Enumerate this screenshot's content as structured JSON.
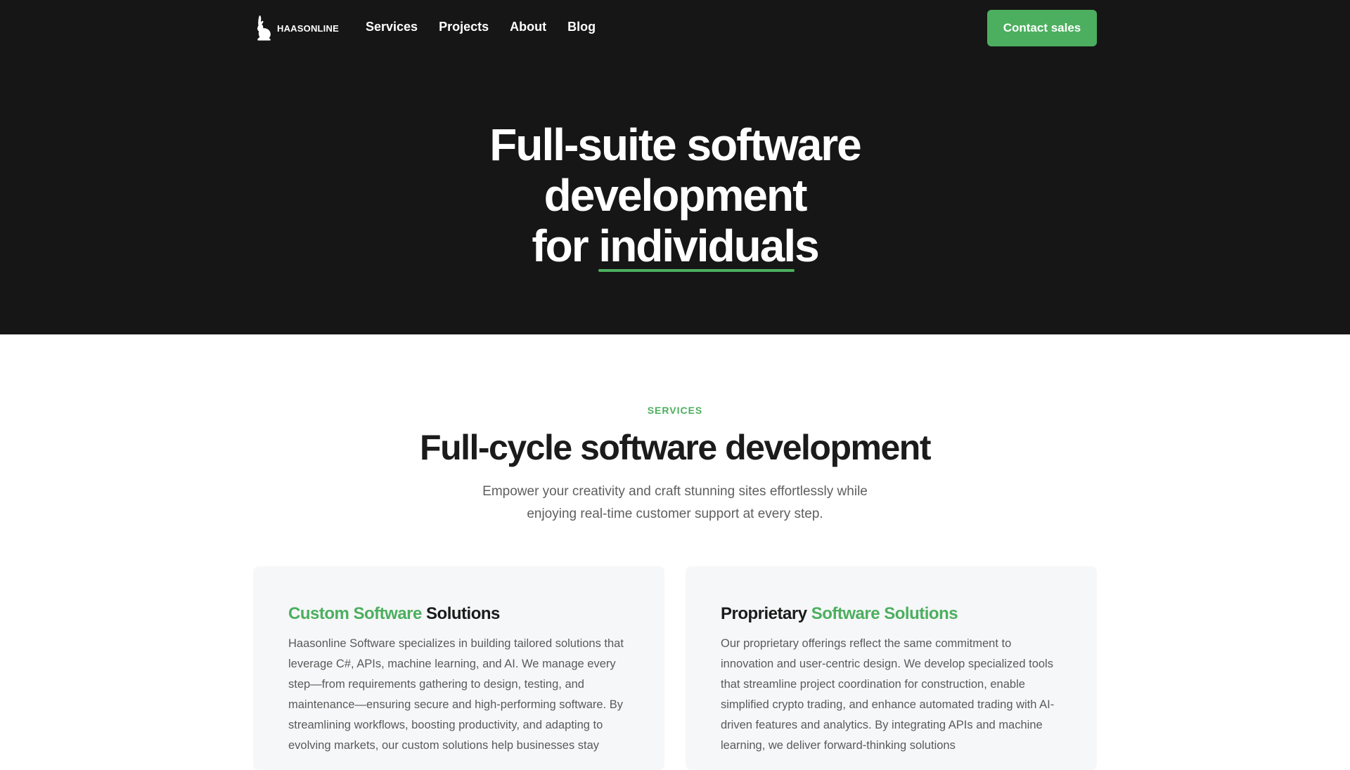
{
  "header": {
    "logo_text": "HAASONLINE",
    "nav": [
      "Services",
      "Projects",
      "About",
      "Blog"
    ],
    "cta_label": "Contact sales"
  },
  "hero": {
    "line1": "Full-suite software",
    "line2": "development",
    "line3_prefix": "for",
    "line3_highlight": "individuals"
  },
  "services": {
    "eyebrow": "SERVICES",
    "title": "Full-cycle software development",
    "subtitle_line1": "Empower your creativity and craft stunning sites effortlessly while",
    "subtitle_line2": "enjoying real-time customer support at every step.",
    "cards": [
      {
        "title_accent": "Custom Software",
        "title_rest": "Solutions",
        "body": "Haasonline Software specializes in building tailored solutions that leverage C#, APIs, machine learning, and AI. We manage every step—from requirements gathering to design, testing, and maintenance—ensuring secure and high-performing software. By streamlining workflows, boosting productivity, and adapting to evolving markets, our custom solutions help businesses stay"
      },
      {
        "title_prefix": "Proprietary",
        "title_accent": "Software Solutions",
        "body": "Our proprietary offerings reflect the same commitment to innovation and user-centric design. We develop specialized tools that streamline project coordination for construction, enable simplified crypto trading, and enhance automated trading with AI-driven features and analytics. By integrating APIs and machine learning, we deliver forward-thinking solutions"
      }
    ]
  },
  "colors": {
    "hero_bg": "#161616",
    "accent_green": "#4caf5f",
    "card_bg": "#f6f7f8",
    "body_text": "#5a5a5a"
  },
  "icons": {
    "logo": "rabbit-logo-icon"
  }
}
